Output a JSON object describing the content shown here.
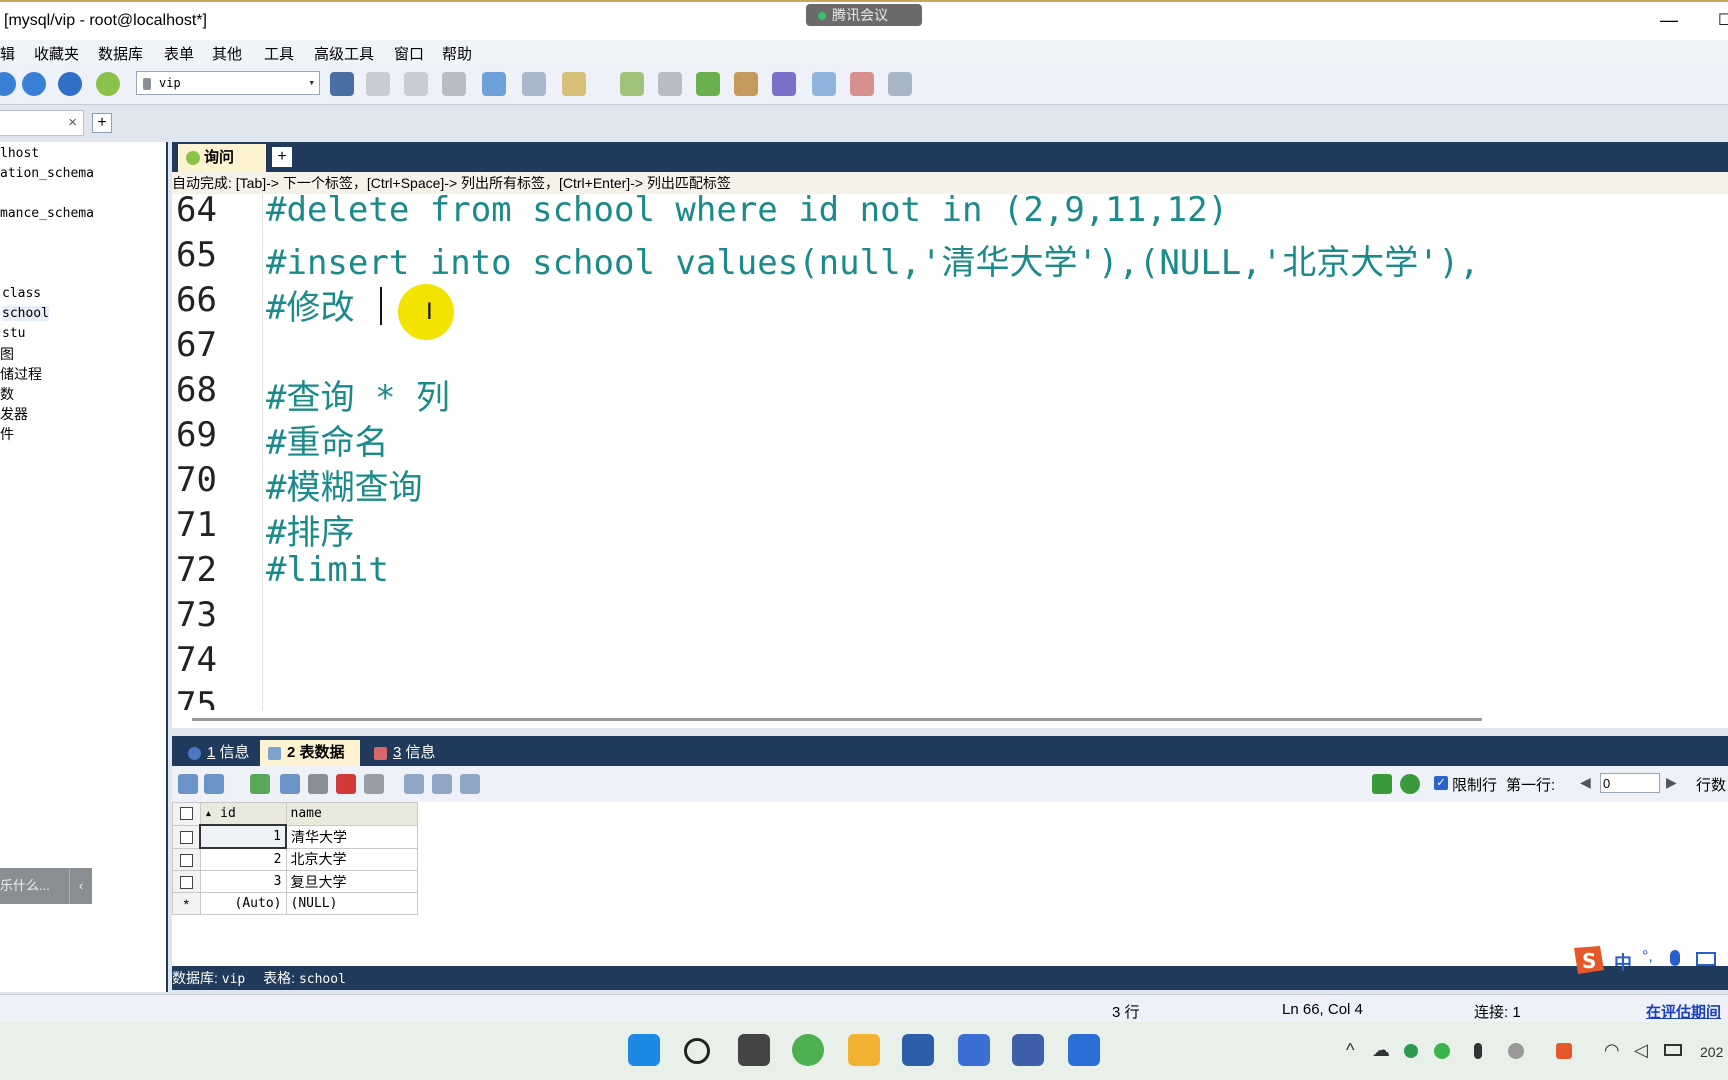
{
  "window": {
    "title": "[mysql/vip - root@localhost*]",
    "meeting_label": "腾讯会议",
    "minimize": "—",
    "maximize": "☐"
  },
  "menu": [
    "辑",
    "收藏夹",
    "数据库",
    "表单",
    "其他",
    "工具",
    "高级工具",
    "窗口",
    "帮助"
  ],
  "toolbar": {
    "db_select": "vip"
  },
  "conn_tab": {
    "close": "×",
    "add": "+"
  },
  "tree": [
    "lhost",
    "ation_schema",
    "mance_schema",
    "class",
    "school",
    "stu",
    "图",
    "储过程",
    "数",
    "发器",
    "件"
  ],
  "left_search": {
    "text": "乐什么...",
    "chevron": "‹"
  },
  "editor": {
    "tab_label": "询问",
    "tab_add": "+",
    "autocomplete": "自动完成:  [Tab]-> 下一个标签，[Ctrl+Space]-> 列出所有标签，[Ctrl+Enter]-> 列出匹配标签",
    "lines": [
      {
        "no": "64",
        "text": "#delete from school where id not in (2,9,11,12)"
      },
      {
        "no": "65",
        "text": "#insert into school values(null,'清华大学'),(NULL,'北京大学'),"
      },
      {
        "no": "66",
        "text": "#修改"
      },
      {
        "no": "67",
        "text": ""
      },
      {
        "no": "68",
        "text": "#查询 * 列"
      },
      {
        "no": "69",
        "text": "#重命名"
      },
      {
        "no": "70",
        "text": "#模糊查询"
      },
      {
        "no": "71",
        "text": "#排序"
      },
      {
        "no": "72",
        "text": "#limit"
      },
      {
        "no": "73",
        "text": ""
      },
      {
        "no": "74",
        "text": ""
      },
      {
        "no": "75",
        "text": ""
      }
    ]
  },
  "results": {
    "tabs": [
      {
        "num": "1",
        "label": "信息",
        "active": false
      },
      {
        "num": "2",
        "label": "表数据",
        "active": true
      },
      {
        "num": "3",
        "label": "信息",
        "active": false
      }
    ],
    "limit_label": "限制行",
    "first_row_label": "第一行:",
    "first_row_value": "0",
    "rows_label": "行数",
    "columns": [
      "id",
      "name"
    ],
    "rows": [
      {
        "id": "1",
        "name": "清华大学"
      },
      {
        "id": "2",
        "name": "北京大学"
      },
      {
        "id": "3",
        "name": "复旦大学"
      },
      {
        "id": "(Auto)",
        "name": "(NULL)"
      }
    ],
    "new_row_marker": "*",
    "status": {
      "db_label": "数据库:",
      "db_value": "vip",
      "table_label": "表格:",
      "table_value": "school"
    }
  },
  "statusbar": {
    "rows": "3 行",
    "position": "Ln 66, Col 4",
    "connections": "连接: 1",
    "trial": "在评估期间"
  },
  "ime": {
    "lang": "中",
    "punct": "°,"
  },
  "taskbar": {
    "clock": "202"
  },
  "colors": {
    "dark_navy": "#1f3a5a",
    "tab_active": "#fdf3d0",
    "code_teal": "#1b8a8a",
    "highlight_yellow": "#f2e400"
  }
}
